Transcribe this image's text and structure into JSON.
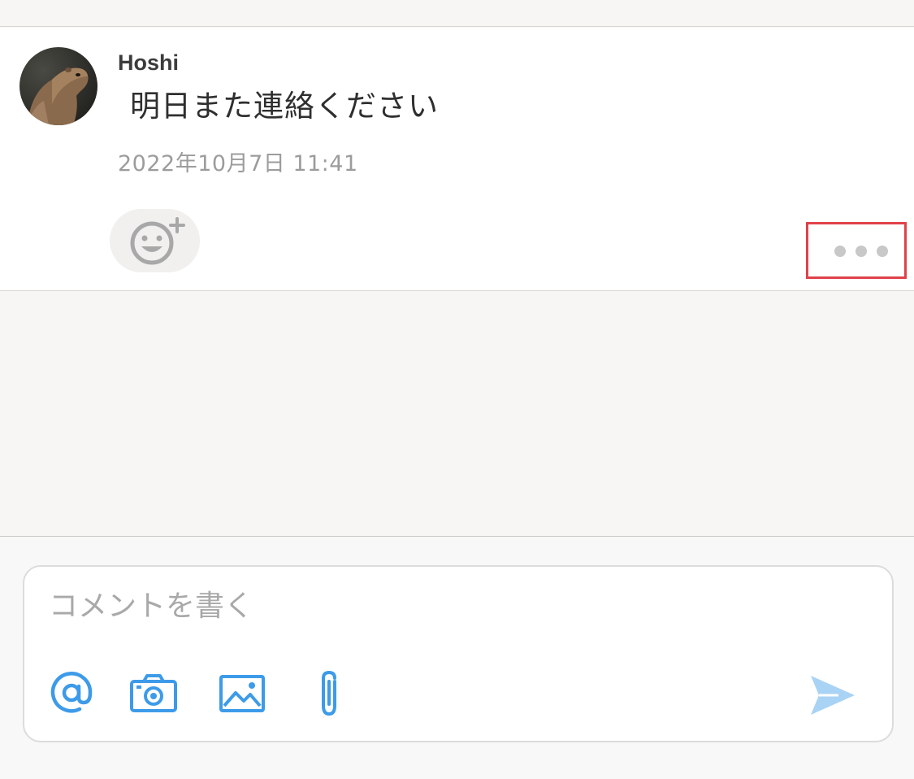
{
  "comment": {
    "author": "Hoshi",
    "text": "明日また連絡ください",
    "timestamp": "2022年10月7日 11:41"
  },
  "icons": {
    "avatar": "capybara-avatar",
    "reaction": "add-emoji-icon",
    "more": "more-options-icon",
    "mention": "at-sign-icon",
    "camera": "camera-icon",
    "image": "image-icon",
    "attach": "paperclip-icon",
    "send": "send-icon"
  },
  "composer": {
    "placeholder": "コメントを書く"
  },
  "colors": {
    "accent": "#3d9be9",
    "send_disabled": "#a9d3f5",
    "highlight": "#e0424a",
    "muted": "#9c9c9c"
  }
}
